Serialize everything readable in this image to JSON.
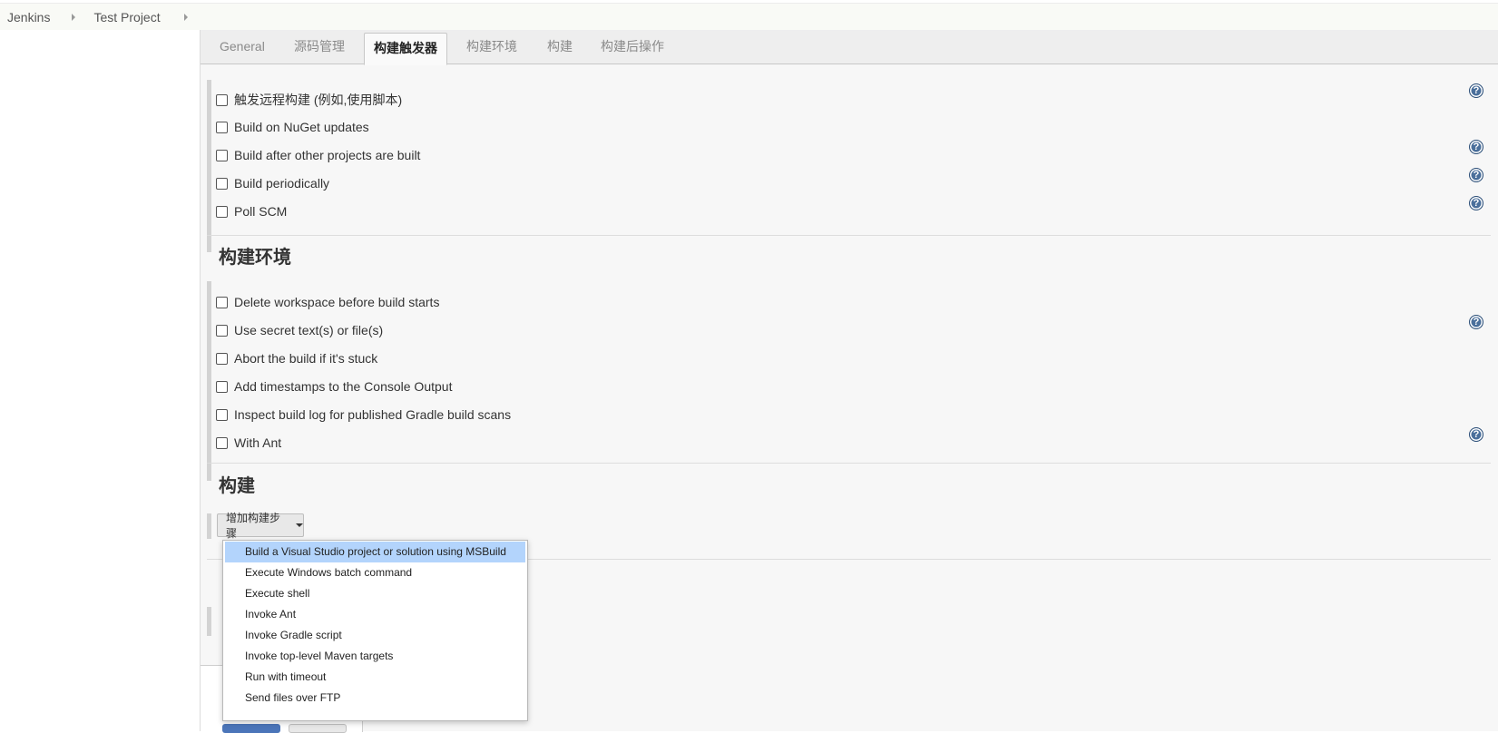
{
  "breadcrumb": {
    "items": [
      "Jenkins",
      "Test Project"
    ]
  },
  "tabs": [
    {
      "label": "General"
    },
    {
      "label": "源码管理"
    },
    {
      "label": "构建触发器",
      "active": true
    },
    {
      "label": "构建环境"
    },
    {
      "label": "构建"
    },
    {
      "label": "构建后操作"
    }
  ],
  "triggers": {
    "items": [
      {
        "label": "触发远程构建 (例如,使用脚本)",
        "help": true
      },
      {
        "label": "Build on NuGet updates",
        "help": false
      },
      {
        "label": "Build after other projects are built",
        "help": true
      },
      {
        "label": "Build periodically",
        "help": true
      },
      {
        "label": "Poll SCM",
        "help": true
      }
    ]
  },
  "build_env": {
    "title": "构建环境",
    "items": [
      {
        "label": "Delete workspace before build starts",
        "help": false
      },
      {
        "label": "Use secret text(s) or file(s)",
        "help": true
      },
      {
        "label": "Abort the build if it's stuck",
        "help": false
      },
      {
        "label": "Add timestamps to the Console Output",
        "help": false
      },
      {
        "label": "Inspect build log for published Gradle build scans",
        "help": false
      },
      {
        "label": "With Ant",
        "help": true
      }
    ]
  },
  "build": {
    "title": "构建",
    "add_step_label": "增加构建步骤"
  },
  "build_step_menu": {
    "items": [
      "Build a Visual Studio project or solution using MSBuild",
      "Execute Windows batch command",
      "Execute shell",
      "Invoke Ant",
      "Invoke Gradle script",
      "Invoke top-level Maven targets",
      "Run with timeout",
      "Send files over FTP"
    ],
    "highlighted_index": 0
  },
  "colors": {
    "menu_highlight": "#b3d4fc",
    "help_icon": "#4a6f9b",
    "section_bar": "#d3d3d3"
  }
}
